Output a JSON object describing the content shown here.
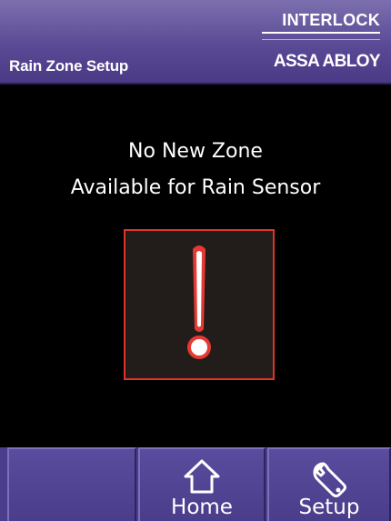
{
  "header": {
    "title": "Rain Zone Setup",
    "brand_top": "INTERLOCK",
    "brand_bottom": "ASSA ABLOY"
  },
  "main": {
    "message_line1": "No New Zone",
    "message_line2": "Available for Rain Sensor",
    "alert_icon": "exclamation-icon"
  },
  "nav": {
    "blank_label": "",
    "home_label": "Home",
    "home_icon": "home-icon",
    "setup_label": "Setup",
    "setup_icon": "wrench-icon"
  },
  "colors": {
    "header_bg": "#5a4a95",
    "nav_bg": "#4a3d8a",
    "alert_border": "#e0332c",
    "alert_bg": "#221d1b",
    "background": "#000000"
  }
}
